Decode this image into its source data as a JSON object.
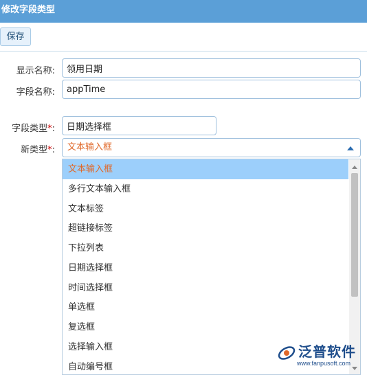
{
  "window": {
    "title": "修改字段类型"
  },
  "toolbar": {
    "save_label": "保存"
  },
  "form": {
    "display_name": {
      "label": "显示名称:",
      "value": "领用日期"
    },
    "field_name": {
      "label": "字段名称:",
      "value": "appTime"
    },
    "field_type": {
      "label": "字段类型",
      "required_mark": "*",
      "colon": ":",
      "value": "日期选择框"
    },
    "new_type": {
      "label": "新类型",
      "required_mark": "*",
      "colon": ":",
      "value": "文本输入框"
    }
  },
  "dropdown": {
    "selected_index": 0,
    "options": [
      "文本输入框",
      "多行文本输入框",
      "文本标签",
      "超链接标签",
      "下拉列表",
      "日期选择框",
      "时间选择框",
      "单选框",
      "复选框",
      "选择输入框",
      "自动编号框"
    ]
  },
  "watermark": {
    "brand": "泛普软件",
    "url": "www.fanpusoft.com"
  },
  "colors": {
    "title_bar": "#5b9fd7",
    "selected_bg": "#9ccffb",
    "selected_text": "#e0692a"
  }
}
